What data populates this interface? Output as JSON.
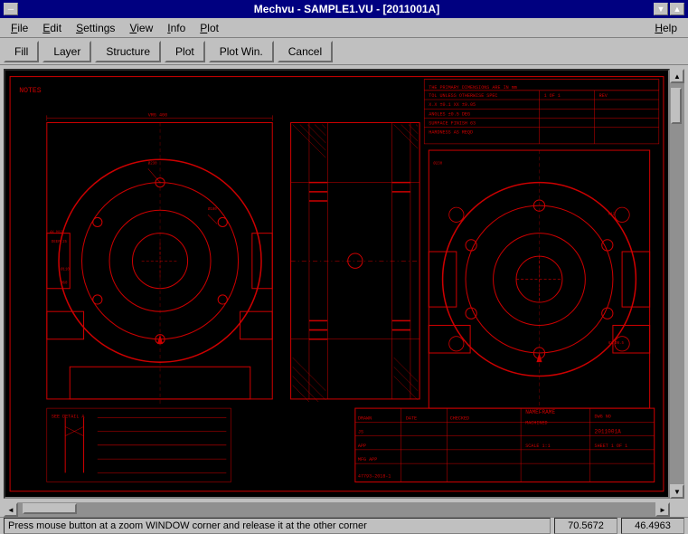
{
  "titleBar": {
    "title": "Mechvu - SAMPLE1.VU - [2011001A]",
    "minBtn": "▲",
    "maxBtn": "▼",
    "closeBtn": "✕"
  },
  "menuBar": {
    "items": [
      {
        "label": "File",
        "underline": "F"
      },
      {
        "label": "Edit",
        "underline": "E"
      },
      {
        "label": "Settings",
        "underline": "S"
      },
      {
        "label": "View",
        "underline": "V"
      },
      {
        "label": "Info",
        "underline": "I"
      },
      {
        "label": "Plot",
        "underline": "P"
      },
      {
        "label": "Help",
        "underline": "H"
      }
    ]
  },
  "toolbar": {
    "buttons": [
      {
        "label": "Fill",
        "name": "fill-button"
      },
      {
        "label": "Layer",
        "name": "layer-button"
      },
      {
        "label": "Structure",
        "name": "structure-button"
      },
      {
        "label": "Plot",
        "name": "plot-button"
      },
      {
        "label": "Plot Win.",
        "name": "plot-win-button"
      },
      {
        "label": "Cancel",
        "name": "cancel-button"
      }
    ]
  },
  "statusBar": {
    "message": "Press mouse button at a zoom WINDOW corner and release it at the other corner",
    "coordX": "70.5672",
    "coordY": "46.4963"
  },
  "scrollBar": {
    "upArrow": "▲",
    "downArrow": "▼",
    "leftArrow": "◄",
    "rightArrow": "►"
  }
}
